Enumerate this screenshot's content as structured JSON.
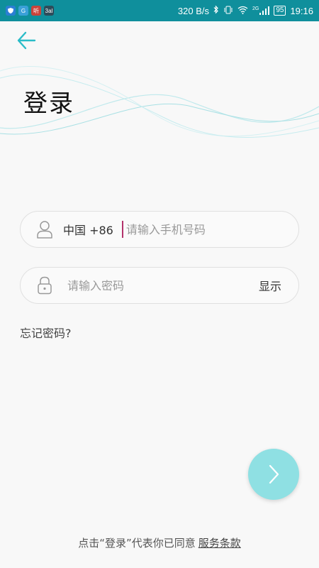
{
  "status_bar": {
    "apps": [
      "shield",
      "G",
      "听",
      "3al"
    ],
    "speed": "320 B/s",
    "network": "2G",
    "battery": "95",
    "time": "19:16"
  },
  "page": {
    "title": "登录"
  },
  "phone_field": {
    "country_code": "中国 +86",
    "placeholder": "请输入手机号码",
    "value": ""
  },
  "password_field": {
    "placeholder": "请输入密码",
    "show_label": "显示"
  },
  "forgot_password": "忘记密码?",
  "agreement": {
    "prefix": "点击“登录”代表你已同意",
    "terms_link": "服务条款"
  },
  "colors": {
    "accent": "#2bbcc8",
    "status_bar": "#0f8f9c",
    "next_button": "#8fe0e3",
    "caret": "#b3336b"
  },
  "icons": {
    "back": "arrow-left-icon",
    "user": "user-icon",
    "lock": "lock-icon",
    "next": "chevron-right-icon"
  }
}
